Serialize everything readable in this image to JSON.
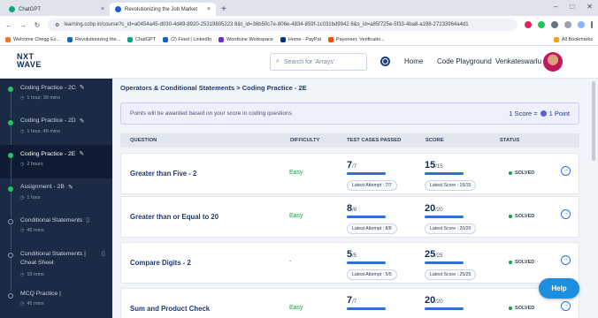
{
  "browser": {
    "tabs": [
      {
        "label": "ChatGPT"
      },
      {
        "label": "Revolutionizing the Job Market"
      }
    ],
    "new_tab": "+",
    "url": "learning.ccbp.in/course?c_id=a0454a45-d030-4d49-8920-25319805223 8&t_id=36b50c7e-806e-4834-859f-1c031bd9942 6&s_id=a85f725e-5f33-4ba8-a198-27233964a4d1",
    "bookmarks": [
      {
        "label": "Welcome Chegg Ex..."
      },
      {
        "label": "Revolutionizing the..."
      },
      {
        "label": "ChatGPT"
      },
      {
        "label": "(2) Feed | LinkedIn"
      },
      {
        "label": "Wordtune Workspace"
      },
      {
        "label": "Home - PayPal"
      },
      {
        "label": "Payoneer, Verificatio..."
      }
    ],
    "all_bookmarks": "All Bookmarks"
  },
  "header": {
    "logo_top": "NXT",
    "logo_bottom": "WAVE",
    "search_placeholder": "Search for 'Arrays'",
    "nav_home": "Home",
    "nav_playground": "Code Playground",
    "username": "Venkateswarlu"
  },
  "sidebar": {
    "items": [
      {
        "title": "Coding Practice - 2C",
        "meta": "1 hour, 30 mins"
      },
      {
        "title": "Coding Practice - 2D",
        "meta": "1 hour, 45 mins"
      },
      {
        "title": "Coding Practice - 2E",
        "meta": "2 hours"
      },
      {
        "title": "Assignment - 2B",
        "meta": "1 hour"
      },
      {
        "title": "Conditional Statements",
        "meta": "45 mins"
      },
      {
        "title": "Conditional Statements | Cheat Sheet",
        "meta": "10 mins"
      },
      {
        "title": "MCQ Practice |",
        "meta": "45 mins"
      }
    ]
  },
  "main": {
    "breadcrumb": "Operators & Conditional Statements > Coding Practice - 2E",
    "notice": "Points will be awarded based on your score in coding questions",
    "rate_left": "1 Score =",
    "rate_right": "1 Point",
    "columns": {
      "question": "QUESTION",
      "difficulty": "DIFFICULTY",
      "tests": "TEST CASES PASSED",
      "score": "SCORE",
      "status": "STATUS"
    },
    "rows": [
      {
        "name": "Greater than Five - 2",
        "difficulty": "Easy",
        "tc": "7",
        "tc_total": "/7",
        "tc_pill": "Latest Attempt : 7/7",
        "sc": "15",
        "sc_total": "/15",
        "sc_pill": "Latest Score : 15/15",
        "status": "SOLVED"
      },
      {
        "name": "Greater than or Equal to 20",
        "difficulty": "Easy",
        "tc": "8",
        "tc_total": "/8",
        "tc_pill": "Latest Attempt : 8/8",
        "sc": "20",
        "sc_total": "/20",
        "sc_pill": "Latest Score : 20/20",
        "status": "SOLVED"
      },
      {
        "name": "Compare Digits - 2",
        "difficulty": "-",
        "tc": "5",
        "tc_total": "/5",
        "tc_pill": "Latest Attempt : 5/5",
        "sc": "25",
        "sc_total": "/25",
        "sc_pill": "Latest Score : 25/25",
        "status": "SOLVED"
      },
      {
        "name": "Sum and Product Check",
        "difficulty": "Easy",
        "tc": "7",
        "tc_total": "/7",
        "tc_pill": "",
        "sc": "20",
        "sc_total": "/20",
        "sc_pill": "",
        "status": "SOLVED"
      }
    ]
  },
  "help": "Help",
  "colors": {
    "accent": "#2d72d9",
    "sidebar": "#1b2a45",
    "success": "#16a34a",
    "help": "#1d8fe0"
  }
}
